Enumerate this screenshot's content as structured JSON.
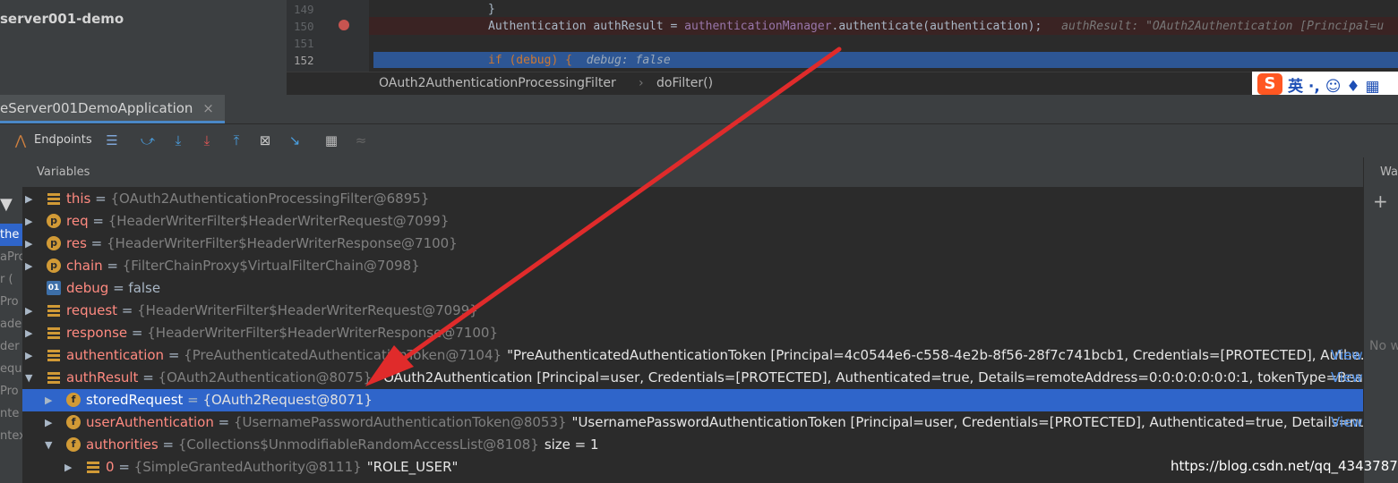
{
  "project": {
    "title": "server001-demo"
  },
  "editor": {
    "line_numbers": [
      "149",
      "150",
      "151",
      "152"
    ],
    "lines": [
      {
        "code": "}",
        "hint": ""
      },
      {
        "code": "Authentication authResult = authenticationManager.authenticate(authentication);",
        "hint": "authResult: \"OAuth2Authentication [Principal=u"
      },
      {
        "code": "",
        "hint": ""
      },
      {
        "code": "if (debug) {",
        "hint": "debug: false"
      }
    ],
    "breadcrumb": [
      "OAuth2AuthenticationProcessingFilter",
      "doFilter()"
    ]
  },
  "ime": {
    "logo": "S",
    "text": "英 ·, ☺ ♦ ▦"
  },
  "debug": {
    "tab_label": "eServer001DemoApplication",
    "tab_close": "×",
    "toolbar": {
      "endpoints_label": "Endpoints"
    },
    "variables_title": "Variables",
    "watches_title": "Wa",
    "watches_plus": "+",
    "watches_empty": "No w",
    "view_label": "View",
    "left_strip": [
      "the",
      "aPro",
      "r (",
      "Pro",
      "ade",
      "der",
      "equ",
      "Pro",
      "nte",
      "ntex"
    ],
    "variables": [
      {
        "indent": 0,
        "icon": "list",
        "expand": "▶",
        "name": "this",
        "type": "{OAuth2AuthenticationProcessingFilter@6895}",
        "value": "",
        "view": false
      },
      {
        "indent": 0,
        "icon": "p",
        "expand": "▶",
        "name": "req",
        "type": "{HeaderWriterFilter$HeaderWriterRequest@7099}",
        "value": "",
        "view": false
      },
      {
        "indent": 0,
        "icon": "p",
        "expand": "▶",
        "name": "res",
        "type": "{HeaderWriterFilter$HeaderWriterResponse@7100}",
        "value": "",
        "view": false
      },
      {
        "indent": 0,
        "icon": "p",
        "expand": "▶",
        "name": "chain",
        "type": "{FilterChainProxy$VirtualFilterChain@7098}",
        "value": "",
        "view": false
      },
      {
        "indent": 0,
        "icon": "bool",
        "expand": "",
        "name": "debug",
        "type": "",
        "value": "false",
        "view": false
      },
      {
        "indent": 0,
        "icon": "list",
        "expand": "▶",
        "name": "request",
        "type": "{HeaderWriterFilter$HeaderWriterRequest@7099}",
        "value": "",
        "view": false
      },
      {
        "indent": 0,
        "icon": "list",
        "expand": "▶",
        "name": "response",
        "type": "{HeaderWriterFilter$HeaderWriterResponse@7100}",
        "value": "",
        "view": false
      },
      {
        "indent": 0,
        "icon": "list",
        "expand": "▶",
        "name": "authentication",
        "type": "{PreAuthenticatedAuthenticationToken@7104}",
        "value": "\"PreAuthenticatedAuthenticationToken [Principal=4c0544e6-c558-4e2b-8f56-28f7c741bcb1, Credentials=[PROTECTED], Authe...",
        "view": true
      },
      {
        "indent": 0,
        "icon": "list",
        "expand": "▼",
        "name": "authResult",
        "type": "{OAuth2Authentication@8075}",
        "value": "\"OAuth2Authentication [Principal=user, Credentials=[PROTECTED], Authenticated=true, Details=remoteAddress=0:0:0:0:0:0:0:1, tokenType=Beare...",
        "view": true
      },
      {
        "indent": 1,
        "icon": "f",
        "expand": "▶",
        "name": "storedRequest",
        "type": "{OAuth2Request@8071}",
        "value": "",
        "view": false,
        "selected": true
      },
      {
        "indent": 1,
        "icon": "f",
        "expand": "▶",
        "name": "userAuthentication",
        "type": "{UsernamePasswordAuthenticationToken@8053}",
        "value": "\"UsernamePasswordAuthenticationToken [Principal=user, Credentials=[PROTECTED], Authenticated=true, Details=nul...",
        "view": true
      },
      {
        "indent": 1,
        "icon": "f",
        "expand": "▼",
        "name": "authorities",
        "type": "{Collections$UnmodifiableRandomAccessList@8108}",
        "value": "size = 1",
        "view": false
      },
      {
        "indent": 2,
        "icon": "list",
        "expand": "▶",
        "name": "0",
        "type": "{SimpleGrantedAuthority@8111}",
        "value": "\"ROLE_USER\"",
        "view": false
      }
    ]
  },
  "watermark": "https://blog.csdn.net/qq_43437874"
}
